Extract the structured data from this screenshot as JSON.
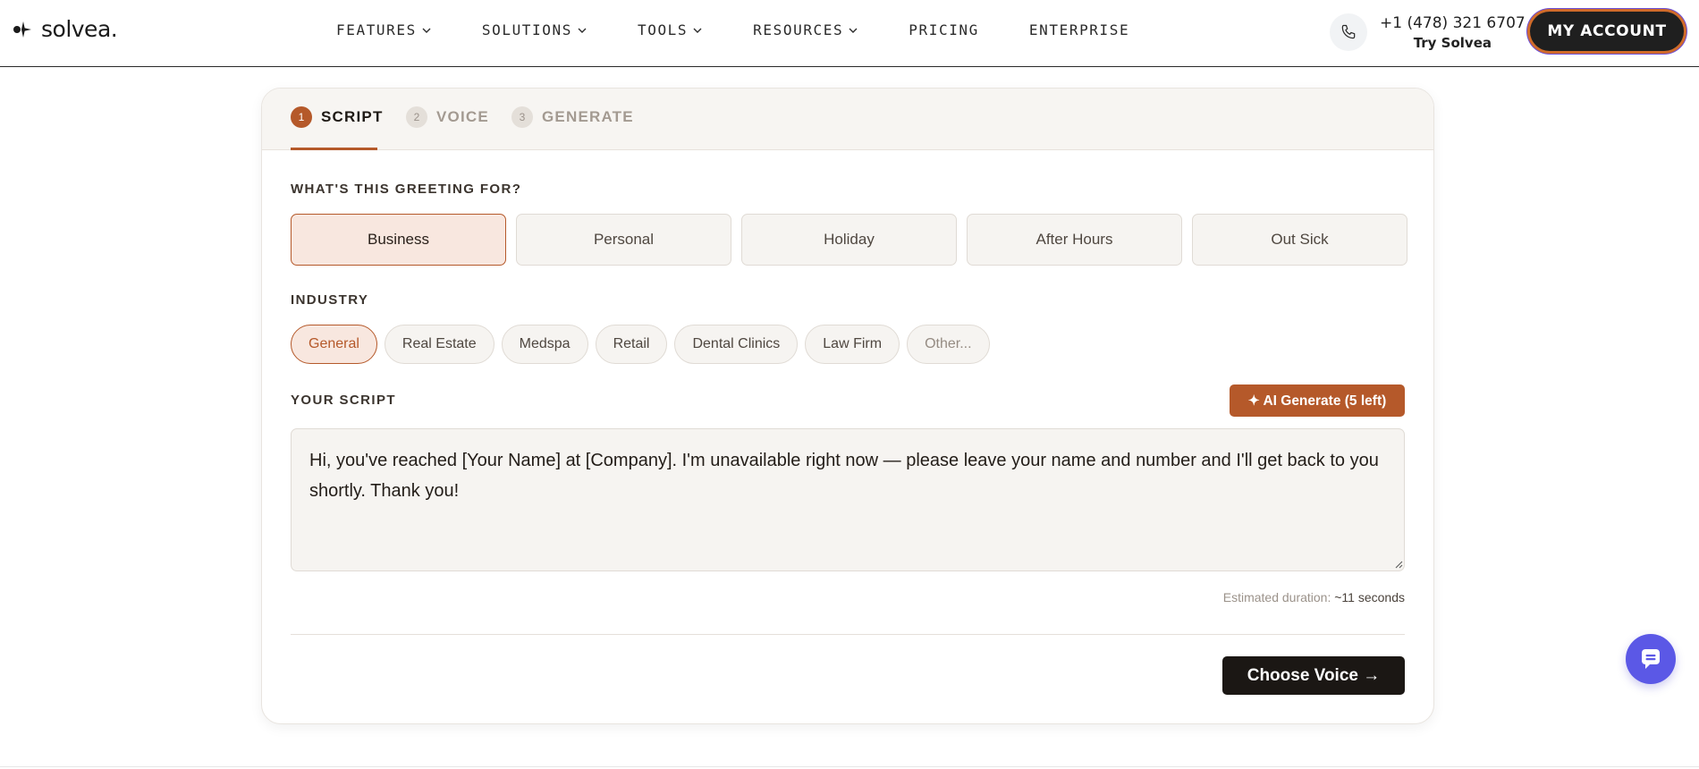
{
  "header": {
    "logo_text": "solvea.",
    "nav": [
      {
        "label": "FEATURES",
        "has_dropdown": true
      },
      {
        "label": "SOLUTIONS",
        "has_dropdown": true
      },
      {
        "label": "TOOLS",
        "has_dropdown": true
      },
      {
        "label": "RESOURCES",
        "has_dropdown": true
      },
      {
        "label": "PRICING",
        "has_dropdown": false
      },
      {
        "label": "ENTERPRISE",
        "has_dropdown": false
      }
    ],
    "phone_number": "+1 (478) 321 6707",
    "phone_sub": "Try Solvea",
    "account_label": "MY ACCOUNT"
  },
  "steps": [
    {
      "num": "1",
      "label": "SCRIPT",
      "active": true
    },
    {
      "num": "2",
      "label": "VOICE",
      "active": false
    },
    {
      "num": "3",
      "label": "GENERATE",
      "active": false
    }
  ],
  "greeting": {
    "label": "WHAT'S THIS GREETING FOR?",
    "options": [
      "Business",
      "Personal",
      "Holiday",
      "After Hours",
      "Out Sick"
    ],
    "selected": "Business"
  },
  "industry": {
    "label": "INDUSTRY",
    "options": [
      "General",
      "Real Estate",
      "Medspa",
      "Retail",
      "Dental Clinics",
      "Law Firm",
      "Other..."
    ],
    "selected": "General"
  },
  "script": {
    "label": "YOUR SCRIPT",
    "ai_button": "✦ AI Generate (5 left)",
    "text": "Hi, you've reached [Your Name] at [Company]. I'm unavailable right now — please leave your name and number and I'll get back to you shortly. Thank you!",
    "duration_label": "Estimated duration:",
    "duration_value": "~11 seconds"
  },
  "next_button": "Choose Voice →",
  "colors": {
    "accent": "#b5592a",
    "accent_bg": "#f8e7df",
    "dark": "#1b1714",
    "chat_fab": "#5b58e6"
  },
  "icons": {
    "logo": "solvea-logo-icon",
    "phone": "phone-icon",
    "chat": "chat-icon",
    "chevron": "chevron-down-icon"
  }
}
